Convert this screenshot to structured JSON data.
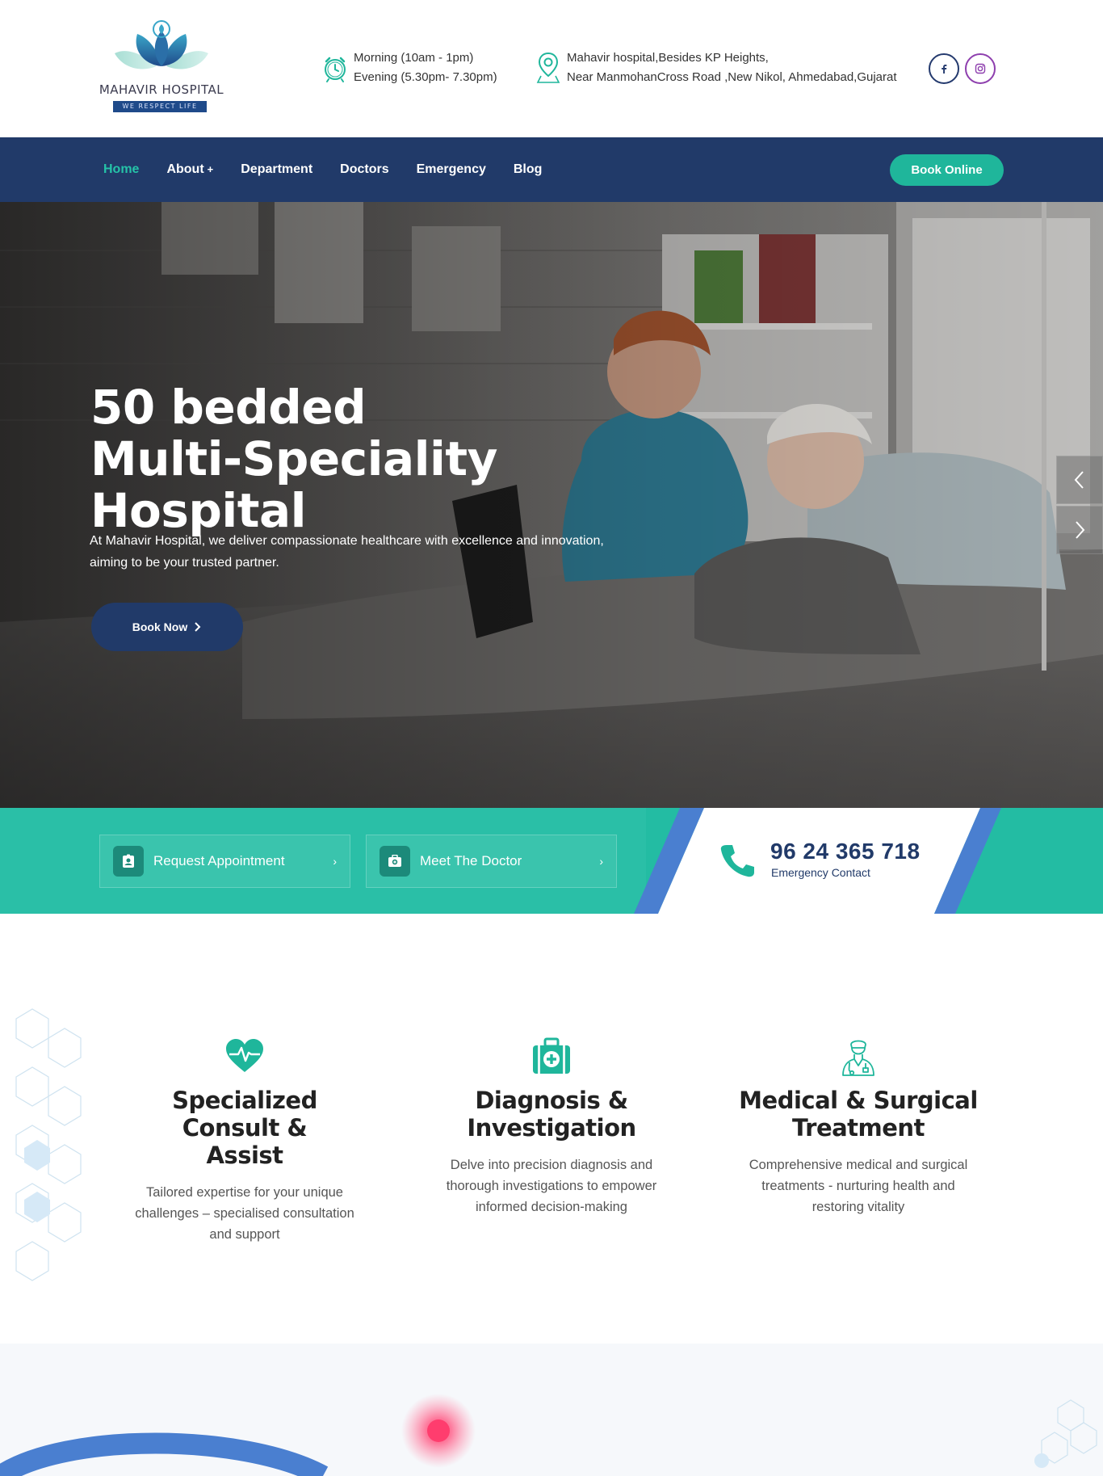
{
  "header": {
    "logo": {
      "name": "MAHAVIR HOSPITAL",
      "tagline": "WE RESPECT LIFE"
    },
    "hours": {
      "morning": "Morning (10am - 1pm)",
      "evening": "Evening (5.30pm- 7.30pm)",
      "icon": "alarm-clock-icon"
    },
    "address": {
      "line1": "Mahavir hospital,Besides KP Heights,",
      "line2": "Near ManmohanCross Road ,New Nikol, Ahmedabad,Gujarat",
      "icon": "map-pin-icon"
    },
    "social": [
      {
        "icon": "facebook-icon"
      },
      {
        "icon": "instagram-icon"
      }
    ]
  },
  "nav": {
    "items": [
      {
        "label": "Home",
        "active": true
      },
      {
        "label": "About",
        "suffix": "+"
      },
      {
        "label": "Department"
      },
      {
        "label": "Doctors"
      },
      {
        "label": "Emergency"
      },
      {
        "label": "Blog"
      }
    ],
    "cta": "Book Online"
  },
  "hero": {
    "title_line1": "50 bedded",
    "title_line2": "Multi-Speciality Hospital",
    "text_line1": "At Mahavir Hospital, we deliver compassionate healthcare with excellence and innovation,",
    "text_line2": "aiming to be your trusted partner.",
    "button": "Book Now"
  },
  "actions": {
    "request": "Request Appointment",
    "meet": "Meet The Doctor",
    "phone": "96 24 365 718",
    "phone_caption": "Emergency Contact"
  },
  "features": [
    {
      "title_line1": "Specialized Consult &",
      "title_line2": "Assist",
      "desc": "Tailored expertise for your unique challenges – specialised consultation and support",
      "icon": "heartbeat-icon"
    },
    {
      "title_line1": "Diagnosis &",
      "title_line2": "Investigation",
      "desc": "Delve into precision diagnosis and thorough investigations to empower informed decision-making",
      "icon": "medical-kit-icon"
    },
    {
      "title_line1": "Medical & Surgical",
      "title_line2": "Treatment",
      "desc": "Comprehensive medical and surgical treatments - nurturing health and restoring vitality",
      "icon": "doctor-icon"
    }
  ],
  "colors": {
    "navy": "#213a69",
    "teal": "#1fb69b",
    "accent_blue": "#4a7fd0"
  }
}
